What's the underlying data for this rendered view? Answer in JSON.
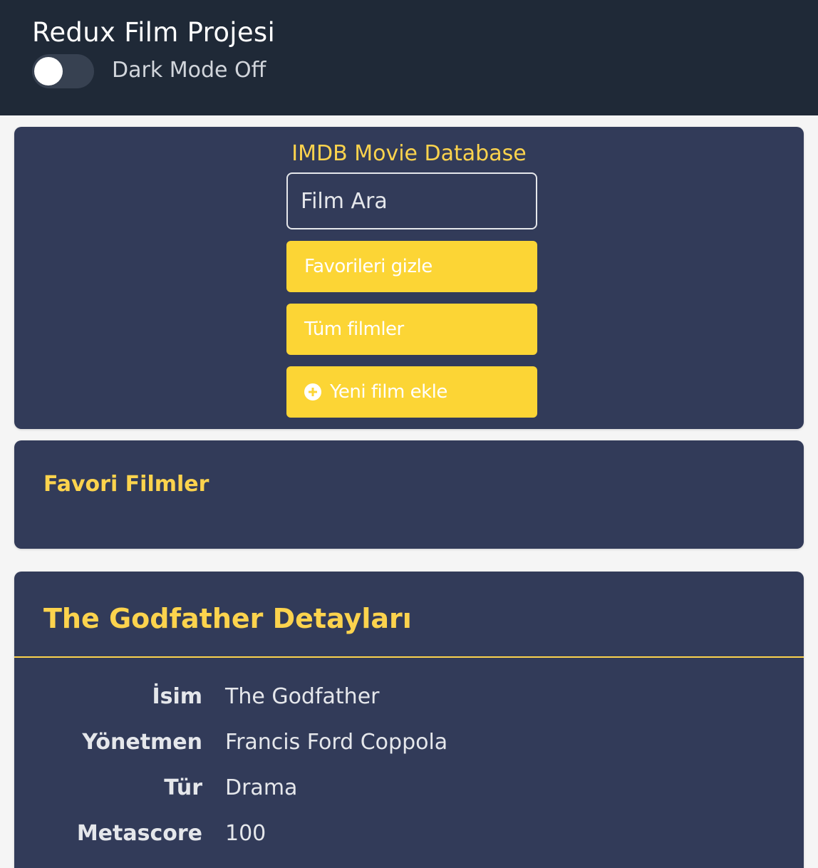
{
  "header": {
    "title": "Redux Film Projesi",
    "dark_mode_label": "Dark Mode Off",
    "dark_mode_on": false
  },
  "search_panel": {
    "title": "IMDB Movie Database",
    "search_placeholder": "Film Ara",
    "hide_favorites_label": "Favorileri gizle",
    "all_movies_label": "Tüm filmler",
    "add_movie_label": "Yeni film ekle"
  },
  "favorites": {
    "title": "Favori Filmler"
  },
  "details": {
    "title": "The Godfather Detayları",
    "fields": [
      {
        "key": "İsim",
        "value": "The Godfather"
      },
      {
        "key": "Yönetmen",
        "value": "Francis Ford Coppola"
      },
      {
        "key": "Tür",
        "value": "Drama"
      },
      {
        "key": "Metascore",
        "value": "100"
      }
    ]
  },
  "colors": {
    "header_bg": "#1f2937",
    "panel_bg": "#323b59",
    "accent": "#fcd535",
    "page_bg": "#f5f5f5"
  }
}
